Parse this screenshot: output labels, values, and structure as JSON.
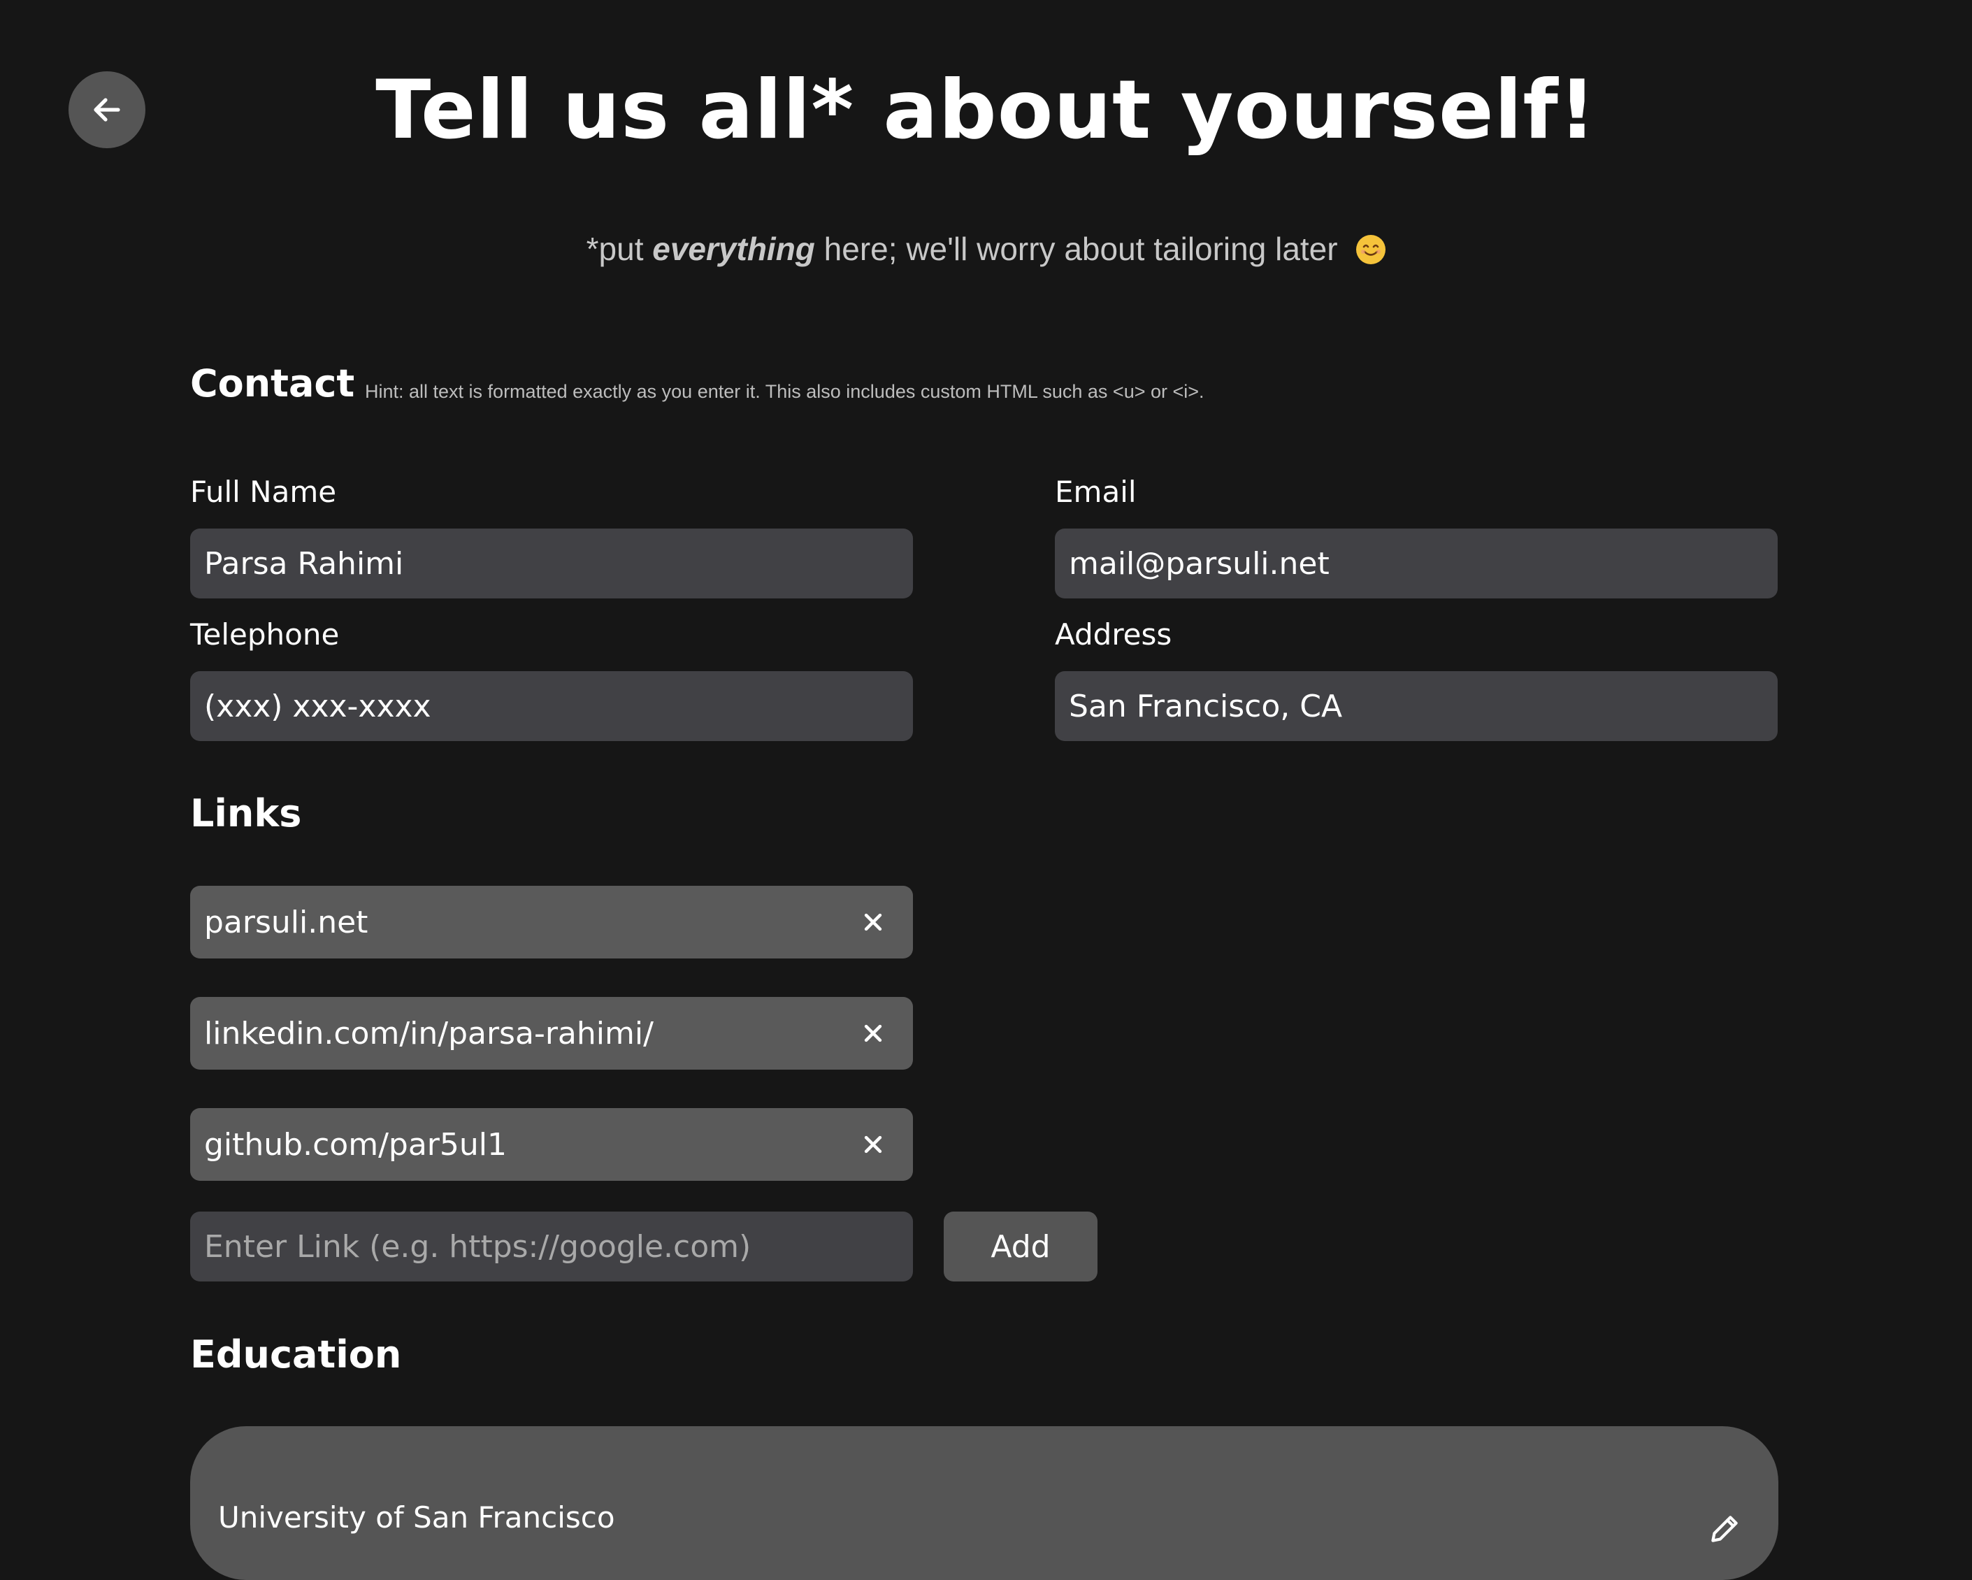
{
  "header": {
    "back_icon": "arrow-left-icon",
    "title": "Tell us all* about yourself!",
    "subtitle_prefix": "*put ",
    "subtitle_emphasis": "everything",
    "subtitle_suffix": " here; we'll worry about tailoring later",
    "subtitle_emoji": "smiling-face-emoji"
  },
  "contact": {
    "title": "Contact",
    "hint": "Hint: all text is formatted exactly as you enter it. This also includes custom HTML such as <u> or <i>.",
    "full_name": {
      "label": "Full Name",
      "value": "Parsa Rahimi"
    },
    "email": {
      "label": "Email",
      "value": "mail@parsuli.net"
    },
    "telephone": {
      "label": "Telephone",
      "value": "(xxx) xxx-xxxx"
    },
    "address": {
      "label": "Address",
      "value": "San Francisco, CA"
    }
  },
  "links": {
    "title": "Links",
    "items": [
      {
        "label": "parsuli.net",
        "remove_icon": "close-icon"
      },
      {
        "label": "linkedin.com/in/parsa-rahimi/",
        "remove_icon": "close-icon"
      },
      {
        "label": "github.com/par5ul1",
        "remove_icon": "close-icon"
      }
    ],
    "new_link": {
      "value": "",
      "placeholder": "Enter Link (e.g. https://google.com)"
    },
    "add_label": "Add"
  },
  "education": {
    "title": "Education",
    "entries": [
      {
        "school": "University of San Francisco",
        "edit_icon": "pencil-icon"
      }
    ]
  },
  "colors": {
    "background": "#161616",
    "input_bg": "#414145",
    "chip_bg": "#5a5a5a",
    "button_bg": "#555555",
    "text": "#ffffff",
    "muted_text": "#c8c8c8"
  }
}
